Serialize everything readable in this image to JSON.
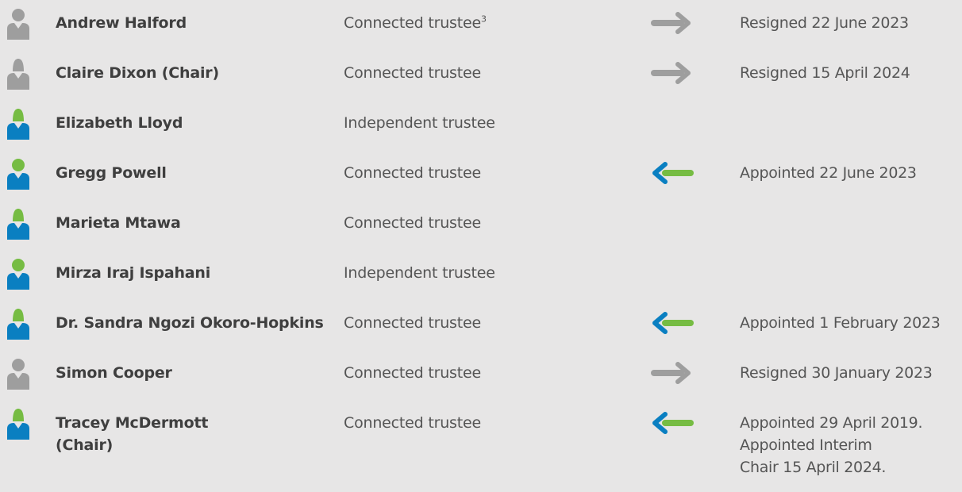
{
  "colors": {
    "background": "#e7e6e6",
    "inactive_icon": "#9e9e9e",
    "active_head": "#76bc43",
    "active_body": "#0a7fc1",
    "arrow_resigned": "#9e9e9e",
    "arrow_appointed_head": "#0a7fc1",
    "arrow_appointed_tail": "#76bc43"
  },
  "trustees": [
    {
      "name_lines": [
        "Andrew Halford"
      ],
      "role": "Connected trustee",
      "role_note": "3",
      "status": "resigned",
      "icon": "person-inactive-icon",
      "change": "arrow-right-icon",
      "status_lines": [
        "Resigned 22 June 2023"
      ]
    },
    {
      "name_lines": [
        "Claire Dixon (Chair)"
      ],
      "role": "Connected trustee",
      "status": "resigned",
      "icon": "person-female-inactive-icon",
      "change": "arrow-right-icon",
      "status_lines": [
        "Resigned 15 April 2024"
      ]
    },
    {
      "name_lines": [
        "Elizabeth Lloyd"
      ],
      "role": "Independent trustee",
      "status": "active",
      "icon": "person-female-active-icon",
      "change": "",
      "status_lines": []
    },
    {
      "name_lines": [
        "Gregg Powell"
      ],
      "role": "Connected trustee",
      "status": "appointed",
      "icon": "person-active-icon",
      "change": "arrow-left-icon",
      "status_lines": [
        "Appointed 22 June 2023"
      ]
    },
    {
      "name_lines": [
        "Marieta Mtawa"
      ],
      "role": "Connected trustee",
      "status": "active",
      "icon": "person-female-active-icon",
      "change": "",
      "status_lines": []
    },
    {
      "name_lines": [
        "Mirza Iraj Ispahani"
      ],
      "role": "Independent trustee",
      "status": "active",
      "icon": "person-active-icon",
      "change": "",
      "status_lines": []
    },
    {
      "name_lines": [
        "Dr. Sandra Ngozi Okoro-Hopkins"
      ],
      "role": "Connected trustee",
      "status": "appointed",
      "icon": "person-female-active-icon",
      "change": "arrow-left-icon",
      "status_lines": [
        "Appointed 1 February 2023"
      ]
    },
    {
      "name_lines": [
        "Simon Cooper"
      ],
      "role": "Connected trustee",
      "status": "resigned",
      "icon": "person-inactive-icon",
      "change": "arrow-right-icon",
      "status_lines": [
        "Resigned 30 January 2023"
      ]
    },
    {
      "name_lines": [
        "Tracey McDermott",
        "(Chair)"
      ],
      "role": "Connected trustee",
      "status": "appointed",
      "icon": "person-female-active-icon",
      "change": "arrow-left-icon",
      "status_lines": [
        "Appointed 29 April 2019.",
        "Appointed Interim",
        "Chair 15 April 2024."
      ]
    }
  ]
}
